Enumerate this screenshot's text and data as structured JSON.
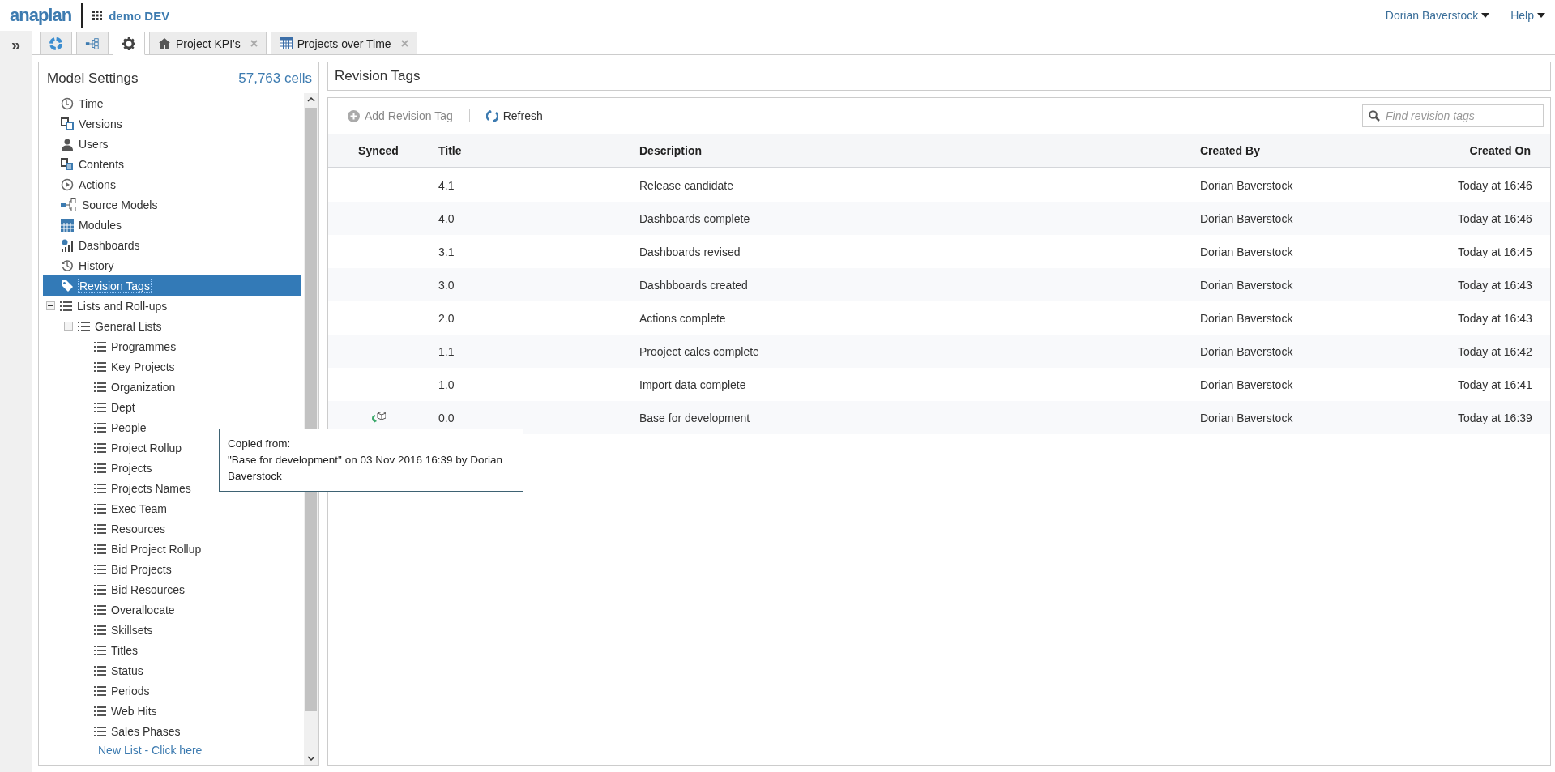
{
  "header": {
    "logo": "anaplan",
    "workspace": "demo DEV",
    "user_menu": "Dorian Baverstock",
    "help_menu": "Help"
  },
  "sidebar_toggle": "»",
  "tabs": [
    {
      "kind": "icon",
      "selected": false
    },
    {
      "kind": "icon",
      "selected": false
    },
    {
      "kind": "icon",
      "selected": true
    },
    {
      "kind": "page",
      "label": "Project KPI's",
      "selected": false
    },
    {
      "kind": "page",
      "label": "Projects over Time",
      "selected": false
    }
  ],
  "settings_panel": {
    "title": "Model Settings",
    "cell_count": "57,763 cells",
    "tree": [
      {
        "label": "Time",
        "selected": false
      },
      {
        "label": "Versions",
        "selected": false
      },
      {
        "label": "Users",
        "selected": false
      },
      {
        "label": "Contents",
        "selected": false
      },
      {
        "label": "Actions",
        "selected": false
      },
      {
        "label": "Source Models",
        "selected": false
      },
      {
        "label": "Modules",
        "selected": false
      },
      {
        "label": "Dashboards",
        "selected": false
      },
      {
        "label": "History",
        "selected": false
      },
      {
        "label": "Revision Tags",
        "selected": true
      },
      {
        "label": "Lists and Roll-ups",
        "selected": false,
        "expanded": true,
        "children": [
          {
            "label": "General Lists",
            "selected": false,
            "expanded": true,
            "children": [
              {
                "label": "Programmes",
                "selected": false
              },
              {
                "label": "Key Projects",
                "selected": false
              },
              {
                "label": "Organization",
                "selected": false
              },
              {
                "label": "Dept",
                "selected": false
              },
              {
                "label": "People",
                "selected": false
              },
              {
                "label": "Project Rollup",
                "selected": false
              },
              {
                "label": "Projects",
                "selected": false
              },
              {
                "label": "Projects Names",
                "selected": false
              },
              {
                "label": "Exec Team",
                "selected": false
              },
              {
                "label": "Resources",
                "selected": false
              },
              {
                "label": "Bid Project Rollup",
                "selected": false
              },
              {
                "label": "Bid Projects",
                "selected": false
              },
              {
                "label": "Bid Resources",
                "selected": false
              },
              {
                "label": "Overallocate",
                "selected": false
              },
              {
                "label": "Skillsets",
                "selected": false
              },
              {
                "label": "Titles",
                "selected": false
              },
              {
                "label": "Status",
                "selected": false
              },
              {
                "label": "Periods",
                "selected": false
              },
              {
                "label": "Web Hits",
                "selected": false
              },
              {
                "label": "Sales Phases",
                "selected": false
              }
            ]
          }
        ]
      }
    ],
    "new_list_link": "New List - Click here"
  },
  "revision_panel": {
    "title": "Revision Tags",
    "toolbar": {
      "add_button": {
        "label": "Add Revision Tag",
        "disabled": true
      },
      "refresh_button": "Refresh",
      "search": {
        "placeholder": "Find revision tags"
      }
    },
    "table": {
      "columns": [
        "Synced",
        "Title",
        "Description",
        "Created By",
        "Created On"
      ],
      "rows": [
        {
          "synced": false,
          "title": "4.1",
          "description": "Release candidate",
          "created_by": "Dorian Baverstock",
          "created_on": "Today at 16:46"
        },
        {
          "synced": false,
          "title": "4.0",
          "description": "Dashboards complete",
          "created_by": "Dorian Baverstock",
          "created_on": "Today at 16:46"
        },
        {
          "synced": false,
          "title": "3.1",
          "description": "Dashboards revised",
          "created_by": "Dorian Baverstock",
          "created_on": "Today at 16:45"
        },
        {
          "synced": false,
          "title": "3.0",
          "description": "Dashbboards created",
          "created_by": "Dorian Baverstock",
          "created_on": "Today at 16:43"
        },
        {
          "synced": false,
          "title": "2.0",
          "description": "Actions complete",
          "created_by": "Dorian Baverstock",
          "created_on": "Today at 16:43"
        },
        {
          "synced": false,
          "title": "1.1",
          "description": "Prooject calcs complete",
          "created_by": "Dorian Baverstock",
          "created_on": "Today at 16:42"
        },
        {
          "synced": false,
          "title": "1.0",
          "description": "Import data complete",
          "created_by": "Dorian Baverstock",
          "created_on": "Today at 16:41"
        },
        {
          "synced": true,
          "title": "0.0",
          "description": "Base for development",
          "created_by": "Dorian Baverstock",
          "created_on": "Today at 16:39"
        }
      ]
    },
    "tooltip": {
      "heading": "Copied from:",
      "body": "\"Base for development\" on 03 Nov 2016 16:39 by Dorian Baverstock"
    }
  }
}
